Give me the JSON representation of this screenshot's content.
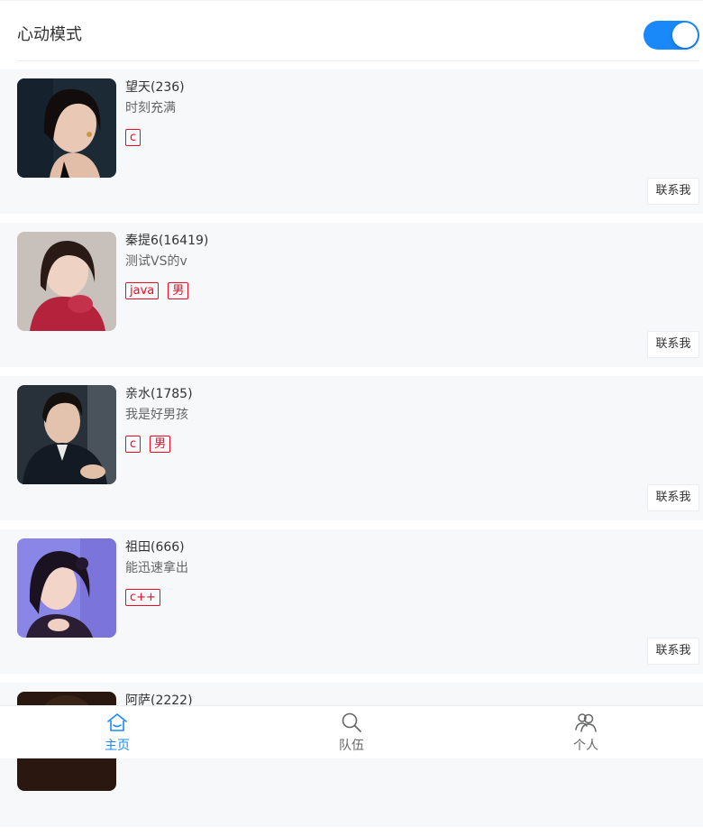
{
  "mode": {
    "label": "心动模式",
    "toggle_on": true,
    "accent_color": "#1989fa"
  },
  "cards": [
    {
      "title": "望天(236)",
      "desc": "时刻充满",
      "tags": [
        "c"
      ],
      "contact_label": "联系我",
      "avatar": "portrait-woman-dark-background"
    },
    {
      "title": "秦提6(16419)",
      "desc": "测试VS的v",
      "tags": [
        "java",
        "男"
      ],
      "contact_label": "联系我",
      "avatar": "portrait-woman-red-sweater"
    },
    {
      "title": "亲水(1785)",
      "desc": "我是好男孩",
      "tags": [
        "c",
        "男"
      ],
      "contact_label": "联系我",
      "avatar": "portrait-man-black-suit"
    },
    {
      "title": "祖田(666)",
      "desc": "能迅速拿出",
      "tags": [
        "c++"
      ],
      "contact_label": "联系我",
      "avatar": "portrait-woman-purple-background"
    },
    {
      "title": "阿萨(2222)",
      "desc": "",
      "tags": [],
      "contact_label": "",
      "avatar": "portrait-partial"
    }
  ],
  "tabbar": {
    "items": [
      {
        "label": "主页",
        "icon": "home-icon",
        "active": true
      },
      {
        "label": "队伍",
        "icon": "search-icon",
        "active": false
      },
      {
        "label": "个人",
        "icon": "friends-icon",
        "active": false
      }
    ]
  },
  "colors": {
    "tag": "#ee0a24",
    "card_bg": "#f7f8fa",
    "tab_active": "#1989fa"
  }
}
